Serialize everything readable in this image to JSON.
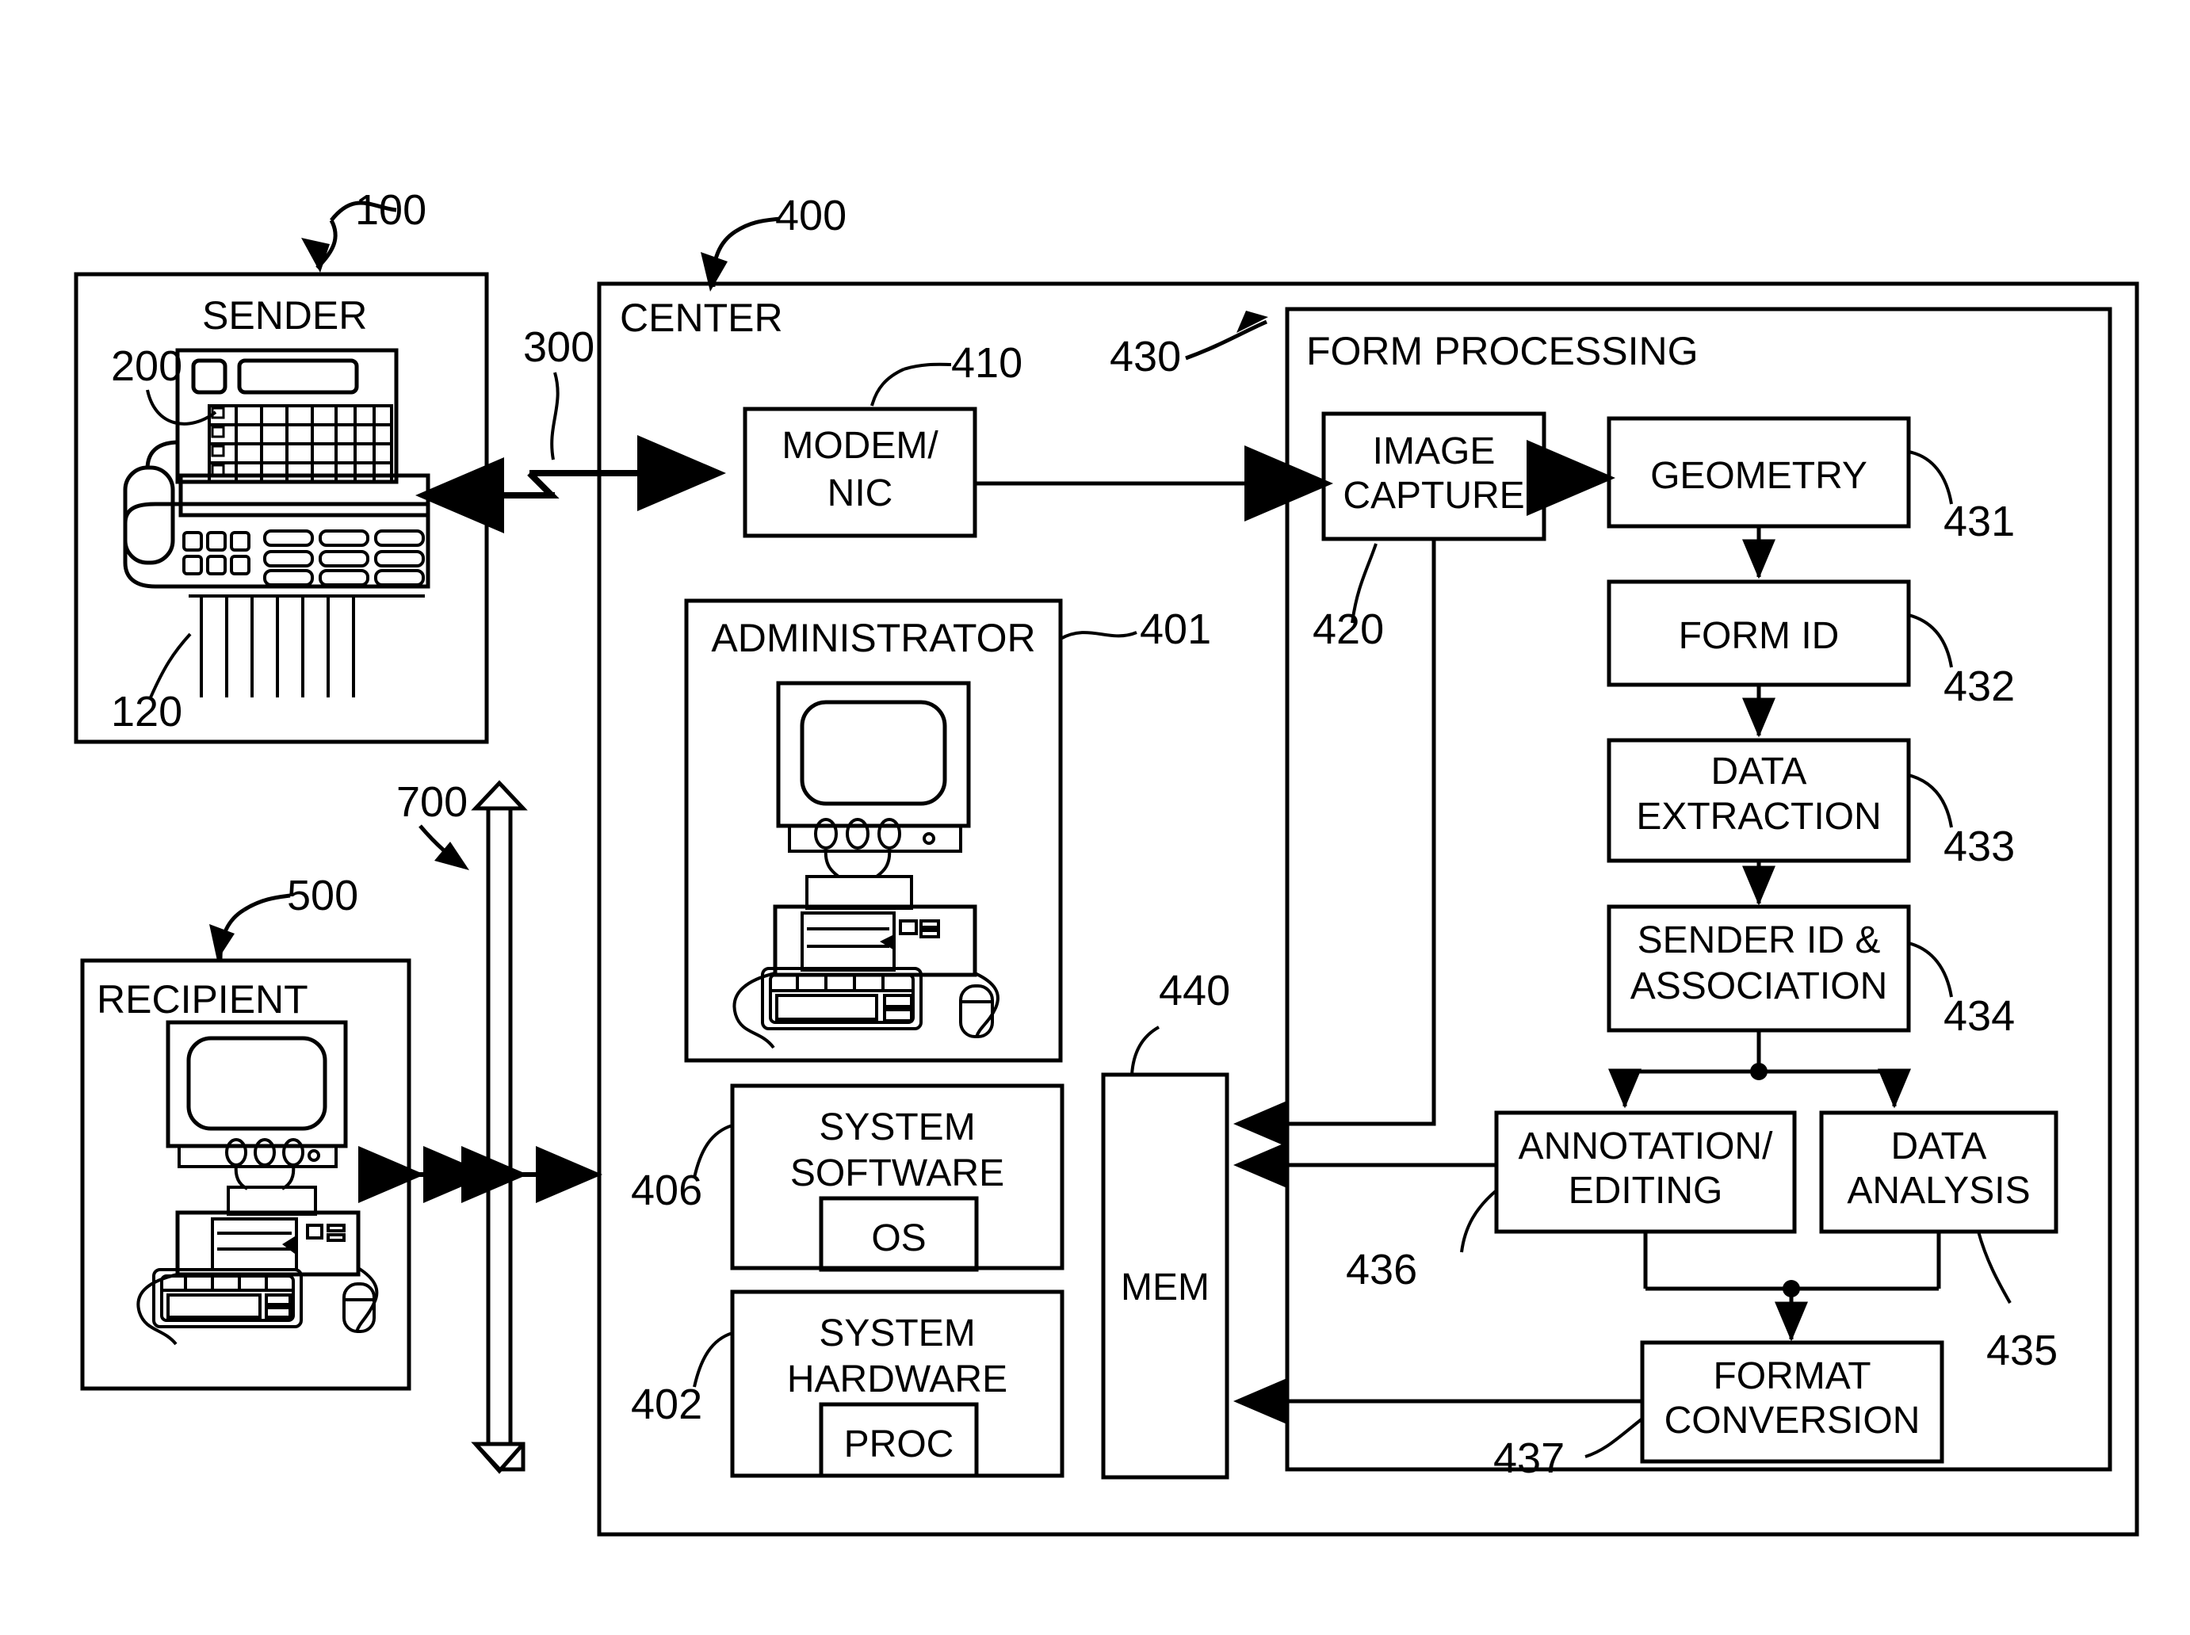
{
  "figure": {
    "type": "patent-block-diagram",
    "background": "#ffffff",
    "stroke": "#000000"
  },
  "blocks": {
    "sender": {
      "title": "SENDER",
      "ref": "100",
      "device_ref": "200",
      "paper_ref": "120",
      "icon": "fax-machine-icon"
    },
    "link": {
      "ref": "300",
      "icon": "telephone-line-zigzag-icon"
    },
    "center": {
      "title": "CENTER",
      "ref": "400"
    },
    "modem": {
      "title_line1": "MODEM/",
      "title_line2": "NIC",
      "ref": "410"
    },
    "administrator": {
      "title": "ADMINISTRATOR",
      "ref": "401",
      "icon": "desktop-computer-icon"
    },
    "system_software": {
      "title_line1": "SYSTEM",
      "title_line2": "SOFTWARE",
      "inner": "OS",
      "ref": "406"
    },
    "system_hardware": {
      "title_line1": "SYSTEM",
      "title_line2": "HARDWARE",
      "inner": "PROC",
      "ref": "402"
    },
    "mem": {
      "title": "MEM",
      "ref": "440"
    },
    "recipient": {
      "title": "RECIPIENT",
      "ref": "500",
      "icon": "desktop-computer-icon"
    },
    "bus": {
      "ref": "700",
      "icon": "double-headed-arrow-icon"
    },
    "form_processing": {
      "title": "FORM PROCESSING",
      "ref": "430",
      "steps": [
        {
          "id": "image_capture",
          "line1": "IMAGE",
          "line2": "CAPTURE",
          "ref": "420"
        },
        {
          "id": "geometry",
          "line1": "GEOMETRY",
          "line2": "",
          "ref": "431"
        },
        {
          "id": "form_id",
          "line1": "FORM ID",
          "line2": "",
          "ref": "432"
        },
        {
          "id": "data_extraction",
          "line1": "DATA",
          "line2": "EXTRACTION",
          "ref": "433"
        },
        {
          "id": "sender_id",
          "line1": "SENDER ID &",
          "line2": "ASSOCIATION",
          "ref": "434"
        },
        {
          "id": "annotation",
          "line1": "ANNOTATION/",
          "line2": "EDITING",
          "ref": "436"
        },
        {
          "id": "data_analysis",
          "line1": "DATA",
          "line2": "ANALYSIS",
          "ref": "435"
        },
        {
          "id": "format_conversion",
          "line1": "FORMAT",
          "line2": "CONVERSION",
          "ref": "437"
        }
      ]
    }
  }
}
